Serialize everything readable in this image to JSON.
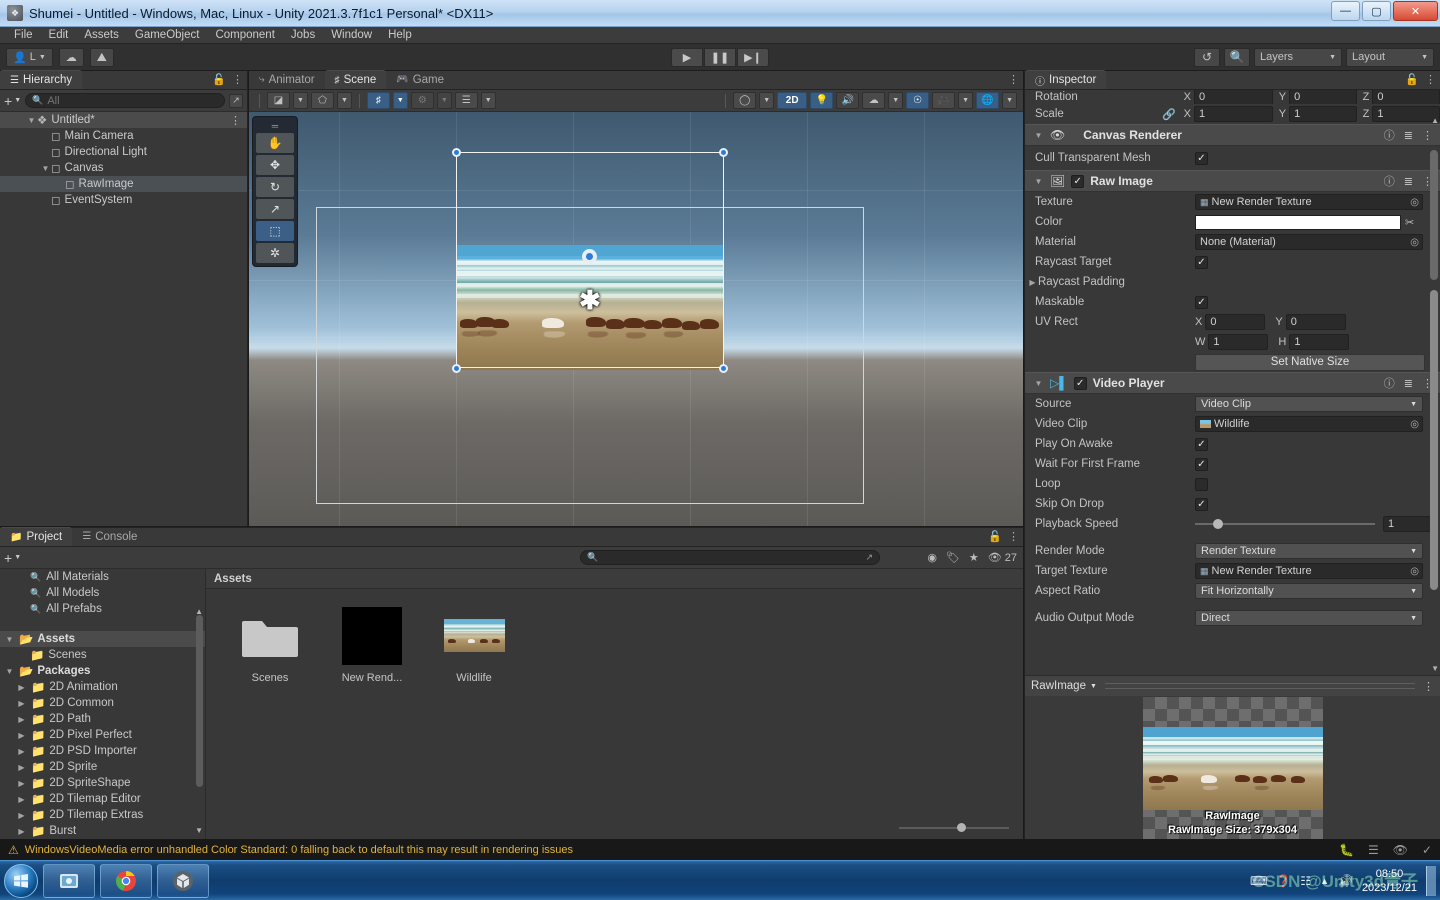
{
  "window": {
    "title": "Shumei - Untitled - Windows, Mac, Linux - Unity 2021.3.7f1c1 Personal* <DX11>",
    "minimize": "—",
    "maximize": "▢",
    "close": "✕"
  },
  "menubar": {
    "items": [
      "File",
      "Edit",
      "Assets",
      "GameObject",
      "Component",
      "Jobs",
      "Window",
      "Help"
    ]
  },
  "toolbar": {
    "account_label": "L",
    "cloud_icon": "cloud-icon",
    "collab_icon": "plastic-scm-icon",
    "play": "▶",
    "pause": "❚❚",
    "step": "▶❙",
    "undo_history_icon": "undo-history-icon",
    "search_icon": "search-icon",
    "layers_label": "Layers",
    "layout_label": "Layout"
  },
  "hierarchy": {
    "tab": "Hierarchy",
    "lock_icon": "lock-icon",
    "menu_icon": "kebab-menu-icon",
    "add_label": "+",
    "search_placeholder": "All",
    "items": [
      {
        "label": "Untitled*",
        "depth": 0,
        "icon": "scene-icon",
        "expanded": true,
        "selected": false,
        "root": true
      },
      {
        "label": "Main Camera",
        "depth": 1,
        "icon": "gameobject-icon",
        "expanded": false,
        "selected": false
      },
      {
        "label": "Directional Light",
        "depth": 1,
        "icon": "gameobject-icon",
        "expanded": false,
        "selected": false
      },
      {
        "label": "Canvas",
        "depth": 1,
        "icon": "gameobject-icon",
        "expanded": true,
        "selected": false
      },
      {
        "label": "RawImage",
        "depth": 2,
        "icon": "gameobject-icon",
        "expanded": false,
        "selected": true
      },
      {
        "label": "EventSystem",
        "depth": 1,
        "icon": "gameobject-icon",
        "expanded": false,
        "selected": false
      }
    ]
  },
  "scene": {
    "tabs": [
      {
        "label": "Animator",
        "icon": "animator-icon",
        "active": false
      },
      {
        "label": "Scene",
        "icon": "scene-grid-icon",
        "active": true
      },
      {
        "label": "Game",
        "icon": "game-pad-icon",
        "active": false
      }
    ],
    "menu_icon": "kebab-menu-icon",
    "toolbar": {
      "shading_mode_icon": "shaded-mode-icon",
      "draw_mode_icon": "wireframe-cube-icon",
      "grid_icon": "grid-axis-icon",
      "grid_snap_icon": "grid-snapping-icon",
      "snap_increment_icon": "snap-increment-icon",
      "gizmo_visibility_icon": "gizmo-sphere-icon",
      "mode_2d": "2D",
      "light_icon": "light-bulb-icon",
      "audio_icon": "audio-mute-icon",
      "fx_icon": "effects-icon",
      "hidden_icon": "hidden-objects-icon",
      "camera_icon": "scene-camera-icon",
      "gizmos_icon": "gizmos-globe-icon"
    },
    "tools": [
      {
        "name": "hand-tool",
        "glyph": "✋",
        "active": false
      },
      {
        "name": "move-tool",
        "glyph": "✥",
        "active": false
      },
      {
        "name": "rotate-tool",
        "glyph": "⟳",
        "active": false
      },
      {
        "name": "scale-tool",
        "glyph": "⤢",
        "active": false
      },
      {
        "name": "rect-tool",
        "glyph": "⬚",
        "active": true
      },
      {
        "name": "transform-tool",
        "glyph": "✣",
        "active": false
      }
    ]
  },
  "project": {
    "tabs": [
      {
        "label": "Project",
        "icon": "folder-icon",
        "active": true
      },
      {
        "label": "Console",
        "icon": "console-icon",
        "active": false
      }
    ],
    "add_label": "+",
    "search_placeholder": "",
    "search_icon": "search-icon",
    "filter_icons": [
      "type-filter-icon",
      "label-filter-icon",
      "favorite-star-icon"
    ],
    "hidden_count": "27",
    "tree": [
      {
        "label": "All Materials",
        "depth": 1,
        "kind": "search",
        "expandable": false
      },
      {
        "label": "All Models",
        "depth": 1,
        "kind": "search",
        "expandable": false
      },
      {
        "label": "All Prefabs",
        "depth": 1,
        "kind": "search",
        "expandable": false
      },
      {
        "label": "Assets",
        "depth": 0,
        "kind": "folder-open",
        "expandable": true,
        "expanded": true,
        "selected": true,
        "bold": true
      },
      {
        "label": "Scenes",
        "depth": 1,
        "kind": "folder",
        "expandable": false
      },
      {
        "label": "Packages",
        "depth": 0,
        "kind": "folder-open",
        "expandable": true,
        "expanded": true,
        "bold": true
      },
      {
        "label": "2D Animation",
        "depth": 1,
        "kind": "folder",
        "expandable": true
      },
      {
        "label": "2D Common",
        "depth": 1,
        "kind": "folder",
        "expandable": true
      },
      {
        "label": "2D Path",
        "depth": 1,
        "kind": "folder",
        "expandable": true
      },
      {
        "label": "2D Pixel Perfect",
        "depth": 1,
        "kind": "folder",
        "expandable": true
      },
      {
        "label": "2D PSD Importer",
        "depth": 1,
        "kind": "folder",
        "expandable": true
      },
      {
        "label": "2D Sprite",
        "depth": 1,
        "kind": "folder",
        "expandable": true
      },
      {
        "label": "2D SpriteShape",
        "depth": 1,
        "kind": "folder",
        "expandable": true
      },
      {
        "label": "2D Tilemap Editor",
        "depth": 1,
        "kind": "folder",
        "expandable": true
      },
      {
        "label": "2D Tilemap Extras",
        "depth": 1,
        "kind": "folder",
        "expandable": true
      },
      {
        "label": "Burst",
        "depth": 1,
        "kind": "folder",
        "expandable": true
      }
    ],
    "breadcrumb": "Assets",
    "assets": [
      {
        "label": "Scenes",
        "kind": "folder"
      },
      {
        "label": "New Rend...",
        "kind": "render-texture"
      },
      {
        "label": "Wildlife",
        "kind": "video-clip"
      }
    ]
  },
  "inspector": {
    "tab": "Inspector",
    "tab_icon": "info-icon",
    "lock_icon": "lock-icon",
    "menu_icon": "kebab-menu-icon",
    "transform": {
      "rotation_label": "Rotation",
      "rotation": {
        "x": "0",
        "y": "0",
        "z": "0"
      },
      "scale_label": "Scale",
      "scale_lock_icon": "broken-link-icon",
      "scale": {
        "x": "1",
        "y": "1",
        "z": "1"
      }
    },
    "components": [
      {
        "name": "Canvas Renderer",
        "icon": "canvas-renderer-icon",
        "has_enable_checkbox": false,
        "help_icon": "help-icon",
        "preset_icon": "preset-icon",
        "menu_icon": "kebab-menu-icon",
        "fields": [
          {
            "type": "checkbox",
            "label": "Cull Transparent Mesh",
            "checked": true
          }
        ]
      },
      {
        "name": "Raw Image",
        "icon": "raw-image-icon",
        "has_enable_checkbox": true,
        "enabled": true,
        "help_icon": "help-icon",
        "preset_icon": "preset-icon",
        "menu_icon": "kebab-menu-icon",
        "fields": [
          {
            "type": "object",
            "label": "Texture",
            "value": "New Render Texture",
            "thumb": "render-texture-icon"
          },
          {
            "type": "color",
            "label": "Color",
            "value": "#FFFFFF",
            "picker_icon": "eyedropper-icon"
          },
          {
            "type": "object",
            "label": "Material",
            "value": "None (Material)",
            "thumb": ""
          },
          {
            "type": "checkbox",
            "label": "Raycast Target",
            "checked": true
          },
          {
            "type": "foldout",
            "label": "Raycast Padding",
            "expanded": false
          },
          {
            "type": "checkbox",
            "label": "Maskable",
            "checked": true
          },
          {
            "type": "vector2pair",
            "label": "UV Rect",
            "x_label": "X",
            "x": "0",
            "y_label": "Y",
            "y": "0",
            "w_label": "W",
            "w": "1",
            "h_label": "H",
            "h": "1"
          },
          {
            "type": "button",
            "label": "Set Native Size"
          }
        ]
      },
      {
        "name": "Video Player",
        "icon": "video-player-icon",
        "has_enable_checkbox": true,
        "enabled": true,
        "help_icon": "help-icon",
        "preset_icon": "preset-icon",
        "menu_icon": "kebab-menu-icon",
        "fields": [
          {
            "type": "dropdown",
            "label": "Source",
            "value": "Video Clip"
          },
          {
            "type": "object",
            "label": "Video Clip",
            "value": "Wildlife",
            "thumb": "video-clip-icon"
          },
          {
            "type": "checkbox",
            "label": "Play On Awake",
            "checked": true
          },
          {
            "type": "checkbox",
            "label": "Wait For First Frame",
            "checked": true
          },
          {
            "type": "checkbox",
            "label": "Loop",
            "checked": false
          },
          {
            "type": "checkbox",
            "label": "Skip On Drop",
            "checked": true
          },
          {
            "type": "slider",
            "label": "Playback Speed",
            "value": "1",
            "min": 0,
            "max": 10,
            "fraction": 0.1
          },
          {
            "type": "dropdown",
            "label": "Render Mode",
            "value": "Render Texture"
          },
          {
            "type": "object",
            "label": "Target Texture",
            "value": "New Render Texture",
            "thumb": "render-texture-icon"
          },
          {
            "type": "dropdown",
            "label": "Aspect Ratio",
            "value": "Fit Horizontally"
          },
          {
            "type": "dropdown",
            "label": "Audio Output Mode",
            "value": "Direct"
          }
        ]
      }
    ],
    "preview": {
      "name": "RawImage",
      "dropdown_icon": "chevron-down-icon",
      "menu_icon": "kebab-menu-icon",
      "caption_line1": "RawImage",
      "caption_line2": "RawImage Size: 379x304"
    }
  },
  "statusbar": {
    "warn_icon": "warning-triangle-icon",
    "message": "WindowsVideoMedia error unhandled Color Standard: 0  falling back to default this may result in rendering issues",
    "right_icons": [
      "bug-mute-icon",
      "layers-mute-icon",
      "eye-mute-icon",
      "check-circle-icon"
    ]
  },
  "taskbar": {
    "start_icon": "windows-start-orb",
    "apps": [
      {
        "name": "explorer-icon"
      },
      {
        "name": "chrome-icon"
      },
      {
        "name": "unity-icon"
      }
    ],
    "tray_icons": [
      "keyboard-icon",
      "help-icon",
      "network-icon",
      "show-desktop-arrow"
    ],
    "clock_time": "08:50",
    "clock_date": "2023/12/21",
    "watermark": "CSDN @Unity3d青子"
  },
  "colors": {
    "accent_blue": "#3a5f86",
    "selected_row": "#4b5054",
    "panel_bg": "#383838",
    "warning": "#e2b33a"
  }
}
